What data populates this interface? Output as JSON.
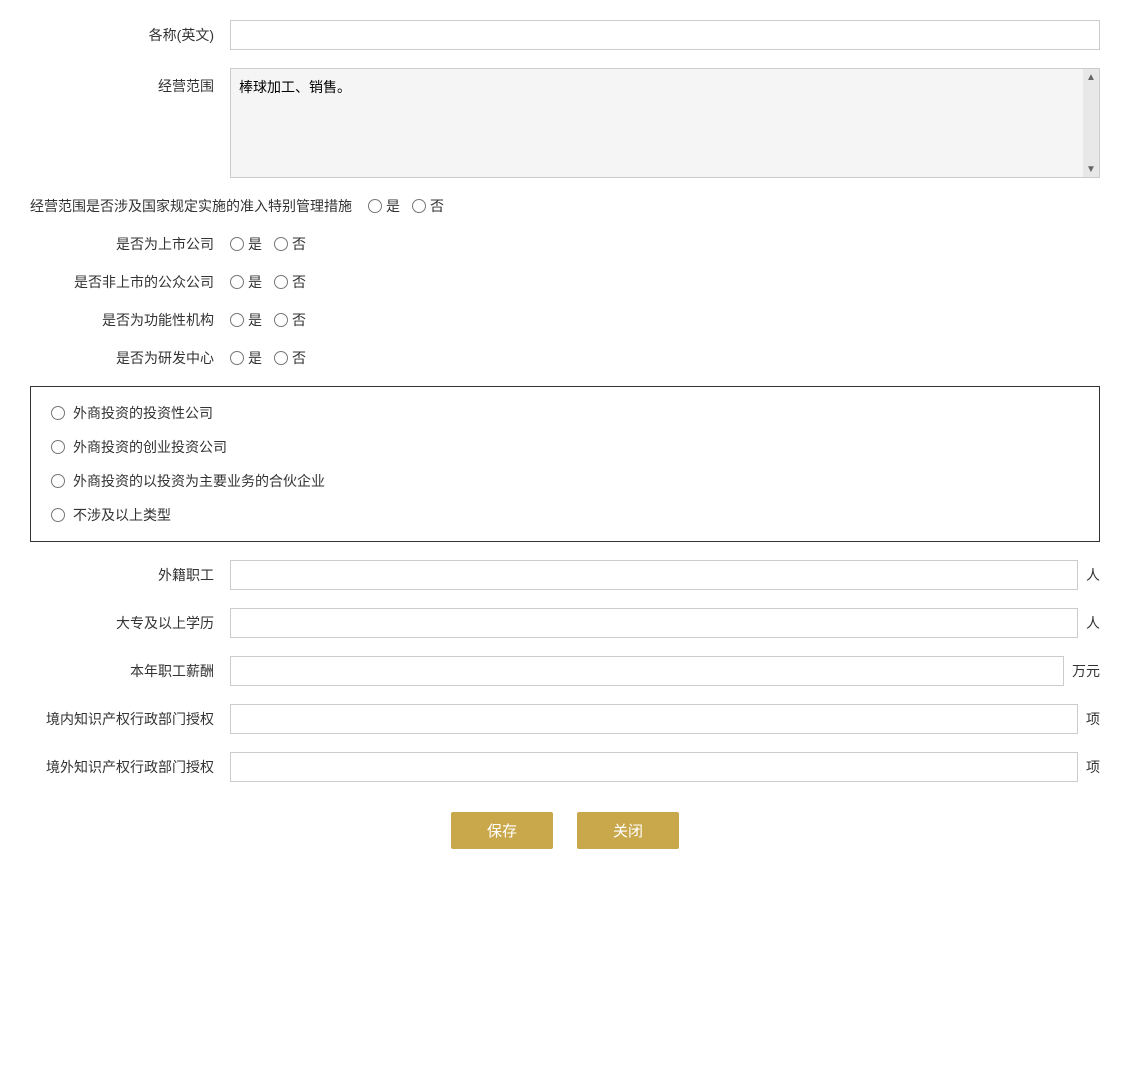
{
  "form": {
    "english_name_label": "各称(英文)",
    "english_name_value": "",
    "english_name_placeholder": "",
    "business_scope_label": "经营范围",
    "business_scope_value": "棒球加工、销售。",
    "special_mgmt_label": "经营范围是否涉及国家规定实施的准入特别管理措施",
    "special_mgmt_yes": "是",
    "special_mgmt_no": "否",
    "listed_company_label": "是否为上市公司",
    "listed_yes": "是",
    "listed_no": "否",
    "public_company_label": "是否非上市的公众公司",
    "public_yes": "是",
    "public_no": "否",
    "functional_org_label": "是否为功能性机构",
    "functional_yes": "是",
    "functional_no": "否",
    "rd_center_label": "是否为研发中心",
    "rd_yes": "是",
    "rd_no": "否",
    "investment_options": [
      "外商投资的投资性公司",
      "外商投资的创业投资公司",
      "外商投资的以投资为主要业务的合伙企业",
      "不涉及以上类型"
    ],
    "foreign_staff_label": "外籍职工",
    "foreign_staff_value": "",
    "foreign_staff_unit": "人",
    "college_edu_label": "大专及以上学历",
    "college_edu_value": "",
    "college_edu_unit": "人",
    "annual_salary_label": "本年职工薪酬",
    "annual_salary_value": "",
    "annual_salary_unit": "万元",
    "domestic_ip_label": "境内知识产权行政部门授权",
    "domestic_ip_value": "",
    "domestic_ip_unit": "项",
    "overseas_ip_label": "境外知识产权行政部门授权",
    "overseas_ip_value": "",
    "overseas_ip_unit": "项",
    "save_button": "保存",
    "close_button": "关闭"
  }
}
